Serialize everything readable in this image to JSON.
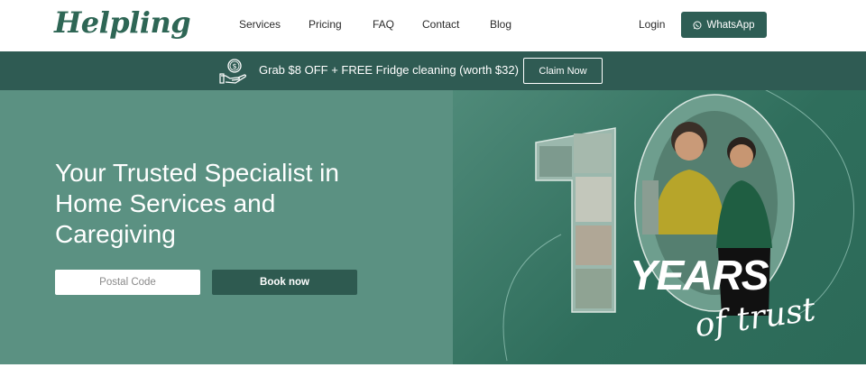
{
  "header": {
    "logo": "Helpling",
    "nav": [
      "Services",
      "Pricing",
      "FAQ",
      "Contact",
      "Blog"
    ],
    "login": "Login",
    "whatsapp": "WhatsApp"
  },
  "promo": {
    "text": "Grab $8 OFF + FREE Fridge cleaning (worth $32)",
    "button": "Claim Now",
    "icon": "money-hand-icon"
  },
  "hero": {
    "title_lines": [
      "Your Trusted Specialist in",
      "Home Services and",
      "Caregiving"
    ],
    "postal_placeholder": "Postal Code",
    "book_button": "Book now",
    "badge_big": "10",
    "badge_years": "YEARS",
    "badge_trust": "of trust"
  },
  "colors": {
    "brand": "#2e6655",
    "promo_bg": "#2f5b53",
    "hero_left": "#5b9182",
    "button_dark": "#2e5a50"
  }
}
